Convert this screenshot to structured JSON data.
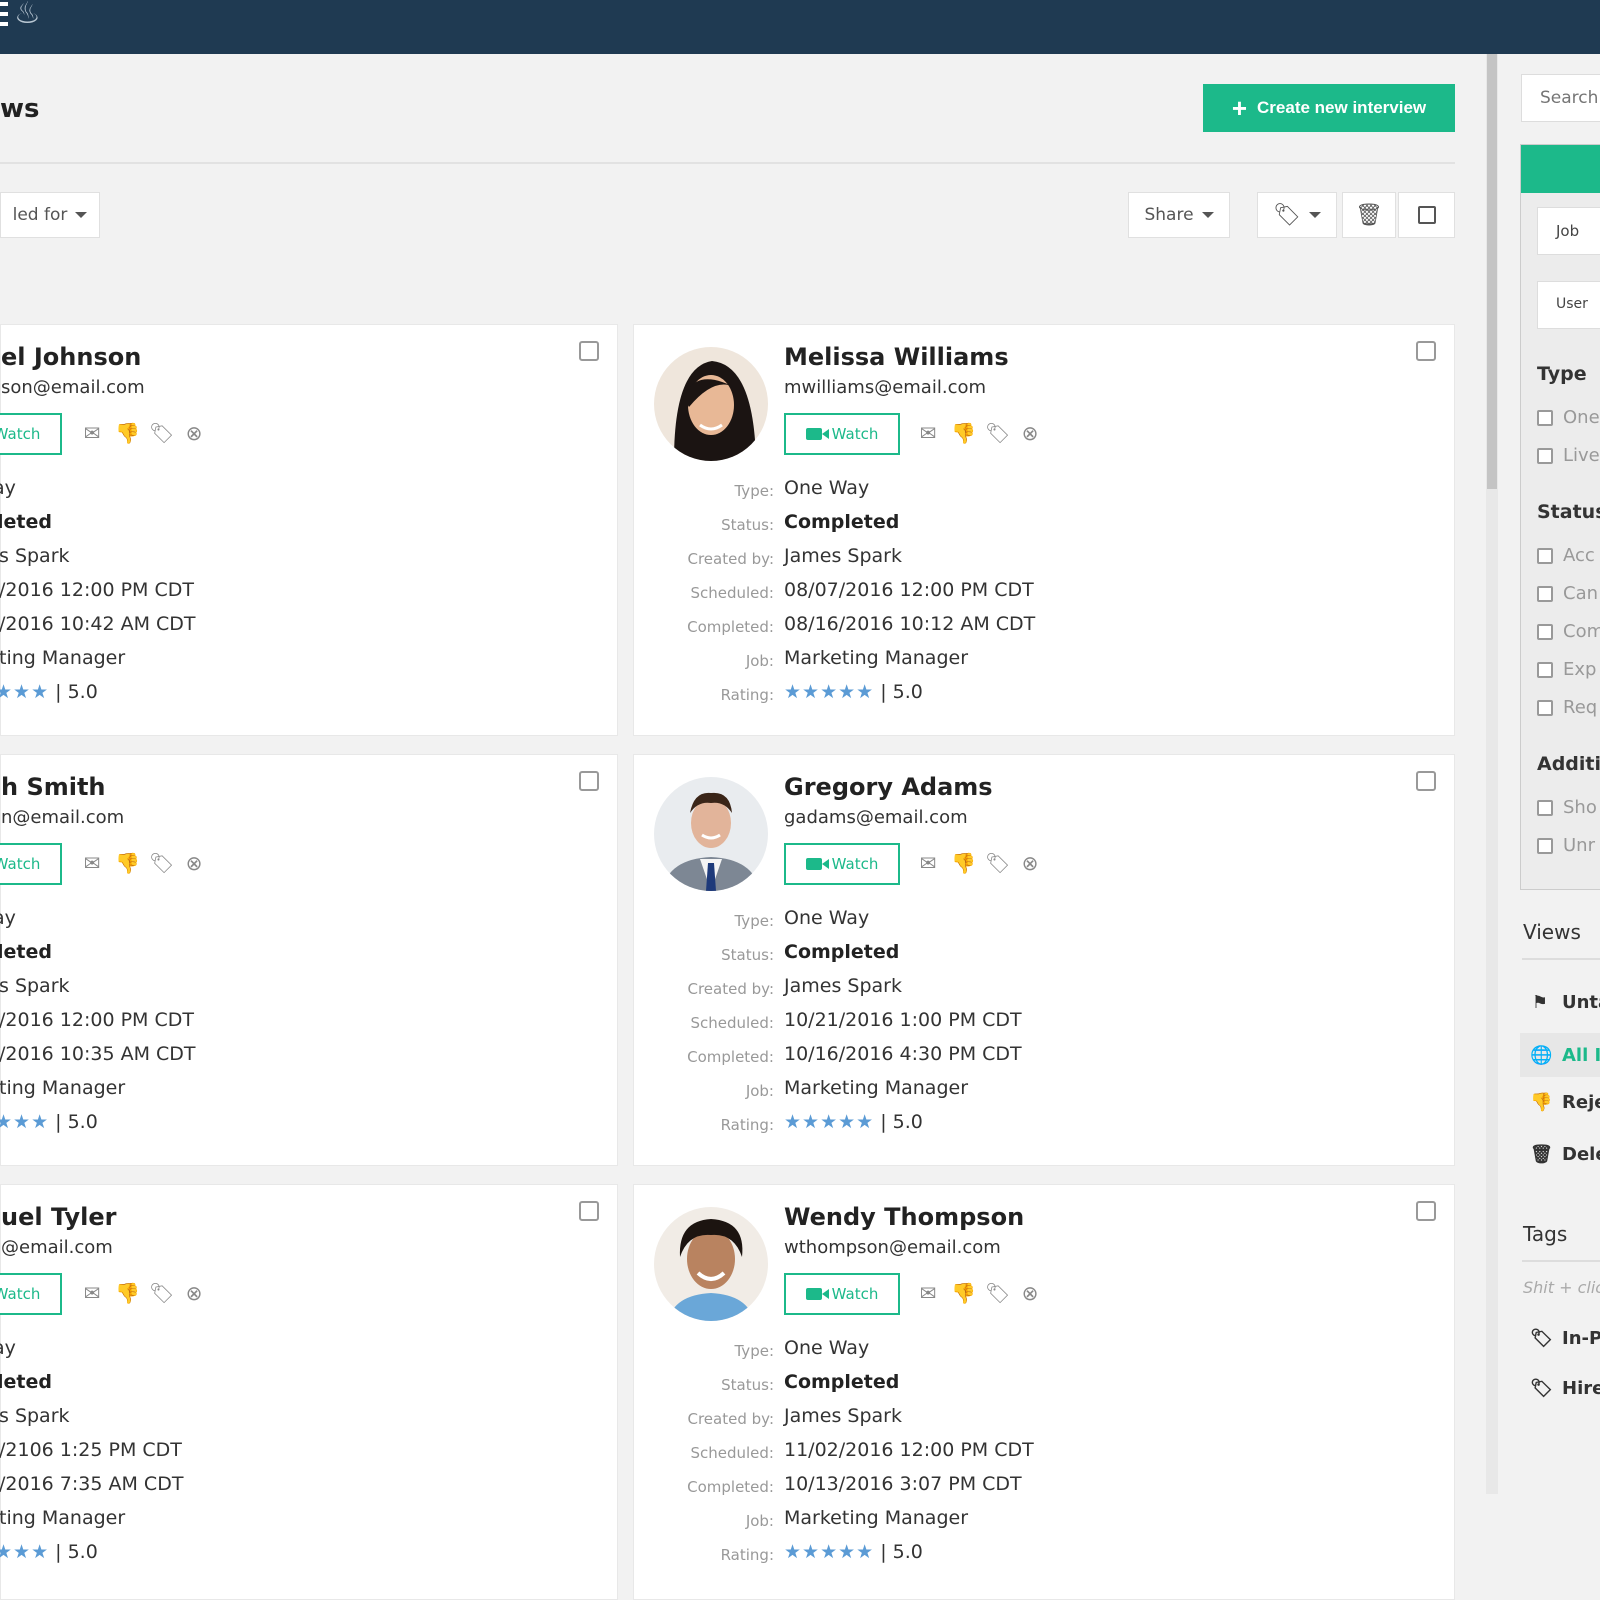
{
  "header": {
    "page_title": "ws",
    "create_button": "Create new interview",
    "filter_dropdown": "led for",
    "share_button": "Share"
  },
  "cards": [
    {
      "name": "el Johnson",
      "email": "son@email.com",
      "watch": "Watch",
      "type": "ay",
      "status": "leted",
      "created_by": "s Spark",
      "scheduled": "/2016 12:00 PM CDT",
      "completed": "/2016 10:42 AM CDT",
      "job": "ting Manager",
      "stars": "★★★",
      "rating": "| 5.0"
    },
    {
      "name": "Melissa Williams",
      "email": "mwilliams@email.com",
      "watch": "Watch",
      "type": "One Way",
      "status": "Completed",
      "created_by": "James Spark",
      "scheduled": "08/07/2016 12:00 PM CDT",
      "completed": "08/16/2016 10:12 AM CDT",
      "job": "Marketing Manager",
      "stars": "★★★★★",
      "rating": "| 5.0"
    },
    {
      "name": "h Smith",
      "email": "n@email.com",
      "watch": "Watch",
      "type": "ay",
      "status": "leted",
      "created_by": "s Spark",
      "scheduled": "/2016 12:00 PM CDT",
      "completed": "/2016 10:35 AM CDT",
      "job": "ting Manager",
      "stars": "★★★",
      "rating": "| 5.0"
    },
    {
      "name": "Gregory Adams",
      "email": "gadams@email.com",
      "watch": "Watch",
      "type": "One Way",
      "status": "Completed",
      "created_by": "James Spark",
      "scheduled": "10/21/2016 1:00 PM CDT",
      "completed": "10/16/2016 4:30 PM CDT",
      "job": "Marketing Manager",
      "stars": "★★★★★",
      "rating": "| 5.0"
    },
    {
      "name": "uel Tyler",
      "email": "@email.com",
      "watch": "Watch",
      "type": "ay",
      "status": "leted",
      "created_by": "s Spark",
      "scheduled": "/2106 1:25 PM CDT",
      "completed": "/2016 7:35 AM CDT",
      "job": "ting Manager",
      "stars": "★★★",
      "rating": "| 5.0"
    },
    {
      "name": "Wendy Thompson",
      "email": "wthompson@email.com",
      "watch": "Watch",
      "type": "One Way",
      "status": "Completed",
      "created_by": "James Spark",
      "scheduled": "11/02/2016 12:00 PM CDT",
      "completed": "10/13/2016 3:07 PM CDT",
      "job": "Marketing Manager",
      "stars": "★★★★★",
      "rating": "| 5.0"
    }
  ],
  "field_labels": {
    "type": "Type:",
    "status": "Status:",
    "created_by": "Created by:",
    "scheduled": "Scheduled:",
    "completed": "Completed:",
    "job": "Job:",
    "rating": "Rating:"
  },
  "sidebar": {
    "search_placeholder": "Search",
    "filter": {
      "job_select": "Job",
      "user_select": "User",
      "type_heading": "Type",
      "type_options": [
        "One",
        "Live"
      ],
      "status_heading": "Status",
      "status_options": [
        "Acc",
        "Can",
        "Com",
        "Exp",
        "Req"
      ],
      "additional_heading": "Additio",
      "additional_options": [
        "Sho",
        "Unr"
      ]
    },
    "views_heading": "Views",
    "views": [
      "Unta",
      "All In",
      "Reje",
      "Dele"
    ],
    "tags_heading": "Tags",
    "tags_hint": "Shit + clic",
    "tags": [
      "In-P",
      "Hire"
    ]
  },
  "colors": {
    "topbar": "#1f3a52",
    "accent": "#1cb98a",
    "star": "#5b9bd5"
  }
}
